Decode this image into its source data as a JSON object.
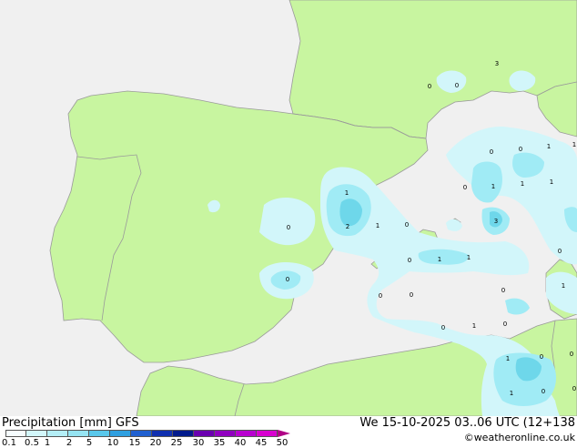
{
  "footer": {
    "title": "Precipitation [mm]  GFS",
    "datetime": "We 15-10-2025 03..06 UTC (12+138",
    "credit": "©weatheronline.co.uk"
  },
  "colors": {
    "sea": "#f0f0f0",
    "land": "#c8f5a0",
    "border": "#9a9a9a",
    "precip_light": "#d2f6fa",
    "precip_mid": "#a0ebf5",
    "precip_heavy": "#6ed7ea"
  },
  "legend": {
    "labels": [
      "0.1",
      "0.5",
      "1",
      "2",
      "5",
      "10",
      "15",
      "20",
      "25",
      "30",
      "35",
      "40",
      "45",
      "50"
    ],
    "colors": [
      "#f5fcfe",
      "#d2f6fa",
      "#b4eef6",
      "#96e4f2",
      "#5ac8eb",
      "#2f9fe0",
      "#2060d0",
      "#1030b0",
      "#001a8c",
      "#6a00b0",
      "#9000c0",
      "#b800d0",
      "#d800d0",
      "#e000b0"
    ]
  },
  "map_labels": [
    {
      "id": "lbl-1",
      "text": "0"
    },
    {
      "id": "lbl-2",
      "text": "0"
    },
    {
      "id": "lbl-3",
      "text": "3"
    },
    {
      "id": "lbl-4",
      "text": "0"
    },
    {
      "id": "lbl-5",
      "text": "0"
    },
    {
      "id": "lbl-6",
      "text": "1"
    },
    {
      "id": "lbl-7",
      "text": "1"
    },
    {
      "id": "lbl-8",
      "text": "0"
    },
    {
      "id": "lbl-9",
      "text": "1"
    },
    {
      "id": "lbl-10",
      "text": "1"
    },
    {
      "id": "lbl-11",
      "text": "1"
    },
    {
      "id": "lbl-12",
      "text": "1"
    },
    {
      "id": "lbl-13",
      "text": "2"
    },
    {
      "id": "lbl-14",
      "text": "1"
    },
    {
      "id": "lbl-15",
      "text": "0"
    },
    {
      "id": "lbl-16",
      "text": "3"
    },
    {
      "id": "lbl-17",
      "text": "0"
    },
    {
      "id": "lbl-18",
      "text": "0"
    },
    {
      "id": "lbl-19",
      "text": "0"
    },
    {
      "id": "lbl-20",
      "text": "1"
    },
    {
      "id": "lbl-21",
      "text": "1"
    },
    {
      "id": "lbl-22",
      "text": "0"
    },
    {
      "id": "lbl-23",
      "text": "1"
    },
    {
      "id": "lbl-24",
      "text": "0"
    },
    {
      "id": "lbl-25",
      "text": "0"
    },
    {
      "id": "lbl-26",
      "text": "0"
    },
    {
      "id": "lbl-27",
      "text": "1"
    },
    {
      "id": "lbl-28",
      "text": "0"
    },
    {
      "id": "lbl-29",
      "text": "0"
    },
    {
      "id": "lbl-30",
      "text": "0"
    },
    {
      "id": "lbl-31",
      "text": "1"
    },
    {
      "id": "lbl-32",
      "text": "0"
    },
    {
      "id": "lbl-33",
      "text": "1"
    },
    {
      "id": "lbl-34",
      "text": "0"
    },
    {
      "id": "lbl-35",
      "text": "0"
    }
  ]
}
